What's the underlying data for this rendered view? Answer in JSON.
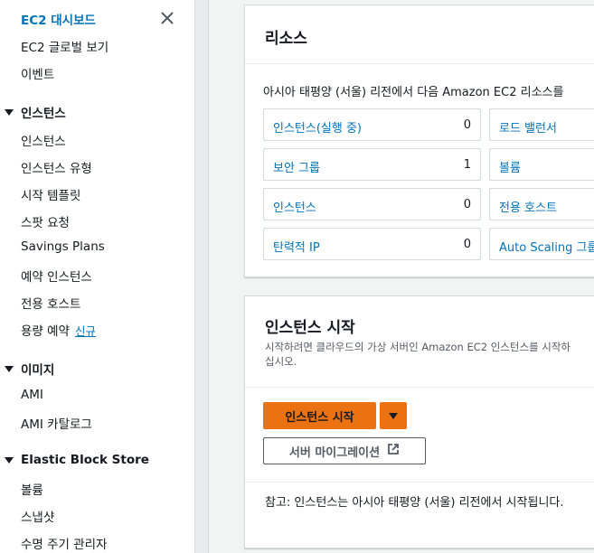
{
  "sidebar": {
    "title": "EC2 대시보드",
    "items_top": [
      "EC2 글로벌 보기",
      "이벤트"
    ],
    "sections": [
      {
        "label": "인스턴스",
        "items": [
          "인스턴스",
          "인스턴스 유형",
          "시작 템플릿",
          "스팟 요청",
          "Savings Plans",
          "예약 인스턴스",
          "전용 호스트",
          "용량 예약"
        ]
      },
      {
        "label": "이미지",
        "items": [
          "AMI",
          "AMI 카탈로그"
        ]
      },
      {
        "label": "Elastic Block Store",
        "items": [
          "볼륨",
          "스냅샷",
          "수명 주기 관리자"
        ]
      }
    ],
    "new_badge": "신규"
  },
  "resources": {
    "title": "리소스",
    "description": "아시아 태평양 (서울) 리전에서 다음 Amazon EC2 리소스를",
    "tiles": [
      {
        "label": "인스턴스(실행 중)",
        "value": "0"
      },
      {
        "label": "로드 밸런서",
        "value": ""
      },
      {
        "label": "보안 그룹",
        "value": "1"
      },
      {
        "label": "볼륨",
        "value": ""
      },
      {
        "label": "인스턴스",
        "value": "0"
      },
      {
        "label": "전용 호스트",
        "value": ""
      },
      {
        "label": "탄력적 IP",
        "value": "0"
      },
      {
        "label": "Auto Scaling 그룹",
        "value": ""
      }
    ]
  },
  "launch": {
    "title": "인스턴스 시작",
    "description": "시작하려면 클라우드의 가상 서버인 Amazon EC2 인스턴스를 시작하십시오.",
    "launch_button": "인스턴스 시작",
    "migrate_button": "서버 마이그레이션",
    "note": "참고: 인스턴스는 아시아 태평양 (서울) 리전에서 시작됩니다."
  },
  "colors": {
    "accent": "#0073bb",
    "primary_button": "#ec7211"
  },
  "icons": {
    "close": "close-icon",
    "caret": "caret-down-icon",
    "external": "external-link-icon"
  }
}
